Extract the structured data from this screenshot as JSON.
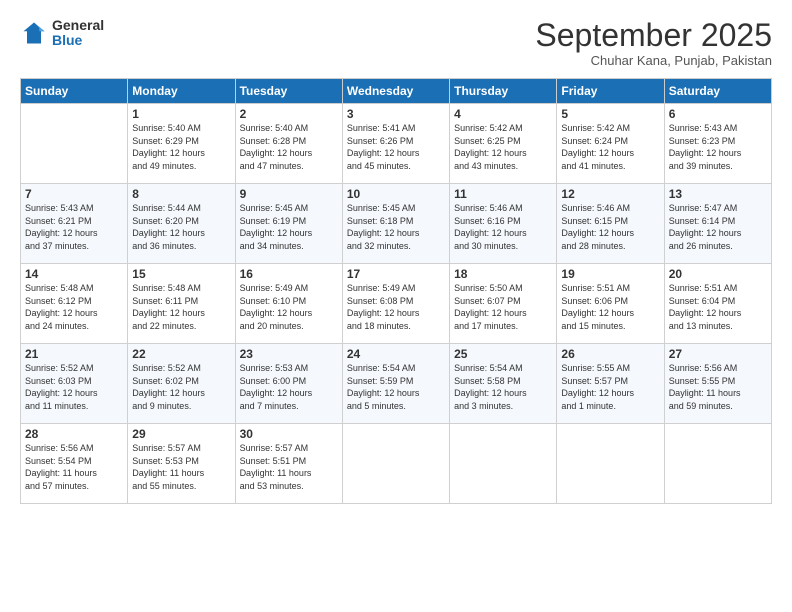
{
  "logo": {
    "general": "General",
    "blue": "Blue"
  },
  "header": {
    "month": "September 2025",
    "location": "Chuhar Kana, Punjab, Pakistan"
  },
  "weekdays": [
    "Sunday",
    "Monday",
    "Tuesday",
    "Wednesday",
    "Thursday",
    "Friday",
    "Saturday"
  ],
  "weeks": [
    [
      {
        "day": "",
        "detail": ""
      },
      {
        "day": "1",
        "detail": "Sunrise: 5:40 AM\nSunset: 6:29 PM\nDaylight: 12 hours\nand 49 minutes."
      },
      {
        "day": "2",
        "detail": "Sunrise: 5:40 AM\nSunset: 6:28 PM\nDaylight: 12 hours\nand 47 minutes."
      },
      {
        "day": "3",
        "detail": "Sunrise: 5:41 AM\nSunset: 6:26 PM\nDaylight: 12 hours\nand 45 minutes."
      },
      {
        "day": "4",
        "detail": "Sunrise: 5:42 AM\nSunset: 6:25 PM\nDaylight: 12 hours\nand 43 minutes."
      },
      {
        "day": "5",
        "detail": "Sunrise: 5:42 AM\nSunset: 6:24 PM\nDaylight: 12 hours\nand 41 minutes."
      },
      {
        "day": "6",
        "detail": "Sunrise: 5:43 AM\nSunset: 6:23 PM\nDaylight: 12 hours\nand 39 minutes."
      }
    ],
    [
      {
        "day": "7",
        "detail": "Sunrise: 5:43 AM\nSunset: 6:21 PM\nDaylight: 12 hours\nand 37 minutes."
      },
      {
        "day": "8",
        "detail": "Sunrise: 5:44 AM\nSunset: 6:20 PM\nDaylight: 12 hours\nand 36 minutes."
      },
      {
        "day": "9",
        "detail": "Sunrise: 5:45 AM\nSunset: 6:19 PM\nDaylight: 12 hours\nand 34 minutes."
      },
      {
        "day": "10",
        "detail": "Sunrise: 5:45 AM\nSunset: 6:18 PM\nDaylight: 12 hours\nand 32 minutes."
      },
      {
        "day": "11",
        "detail": "Sunrise: 5:46 AM\nSunset: 6:16 PM\nDaylight: 12 hours\nand 30 minutes."
      },
      {
        "day": "12",
        "detail": "Sunrise: 5:46 AM\nSunset: 6:15 PM\nDaylight: 12 hours\nand 28 minutes."
      },
      {
        "day": "13",
        "detail": "Sunrise: 5:47 AM\nSunset: 6:14 PM\nDaylight: 12 hours\nand 26 minutes."
      }
    ],
    [
      {
        "day": "14",
        "detail": "Sunrise: 5:48 AM\nSunset: 6:12 PM\nDaylight: 12 hours\nand 24 minutes."
      },
      {
        "day": "15",
        "detail": "Sunrise: 5:48 AM\nSunset: 6:11 PM\nDaylight: 12 hours\nand 22 minutes."
      },
      {
        "day": "16",
        "detail": "Sunrise: 5:49 AM\nSunset: 6:10 PM\nDaylight: 12 hours\nand 20 minutes."
      },
      {
        "day": "17",
        "detail": "Sunrise: 5:49 AM\nSunset: 6:08 PM\nDaylight: 12 hours\nand 18 minutes."
      },
      {
        "day": "18",
        "detail": "Sunrise: 5:50 AM\nSunset: 6:07 PM\nDaylight: 12 hours\nand 17 minutes."
      },
      {
        "day": "19",
        "detail": "Sunrise: 5:51 AM\nSunset: 6:06 PM\nDaylight: 12 hours\nand 15 minutes."
      },
      {
        "day": "20",
        "detail": "Sunrise: 5:51 AM\nSunset: 6:04 PM\nDaylight: 12 hours\nand 13 minutes."
      }
    ],
    [
      {
        "day": "21",
        "detail": "Sunrise: 5:52 AM\nSunset: 6:03 PM\nDaylight: 12 hours\nand 11 minutes."
      },
      {
        "day": "22",
        "detail": "Sunrise: 5:52 AM\nSunset: 6:02 PM\nDaylight: 12 hours\nand 9 minutes."
      },
      {
        "day": "23",
        "detail": "Sunrise: 5:53 AM\nSunset: 6:00 PM\nDaylight: 12 hours\nand 7 minutes."
      },
      {
        "day": "24",
        "detail": "Sunrise: 5:54 AM\nSunset: 5:59 PM\nDaylight: 12 hours\nand 5 minutes."
      },
      {
        "day": "25",
        "detail": "Sunrise: 5:54 AM\nSunset: 5:58 PM\nDaylight: 12 hours\nand 3 minutes."
      },
      {
        "day": "26",
        "detail": "Sunrise: 5:55 AM\nSunset: 5:57 PM\nDaylight: 12 hours\nand 1 minute."
      },
      {
        "day": "27",
        "detail": "Sunrise: 5:56 AM\nSunset: 5:55 PM\nDaylight: 11 hours\nand 59 minutes."
      }
    ],
    [
      {
        "day": "28",
        "detail": "Sunrise: 5:56 AM\nSunset: 5:54 PM\nDaylight: 11 hours\nand 57 minutes."
      },
      {
        "day": "29",
        "detail": "Sunrise: 5:57 AM\nSunset: 5:53 PM\nDaylight: 11 hours\nand 55 minutes."
      },
      {
        "day": "30",
        "detail": "Sunrise: 5:57 AM\nSunset: 5:51 PM\nDaylight: 11 hours\nand 53 minutes."
      },
      {
        "day": "",
        "detail": ""
      },
      {
        "day": "",
        "detail": ""
      },
      {
        "day": "",
        "detail": ""
      },
      {
        "day": "",
        "detail": ""
      }
    ]
  ]
}
